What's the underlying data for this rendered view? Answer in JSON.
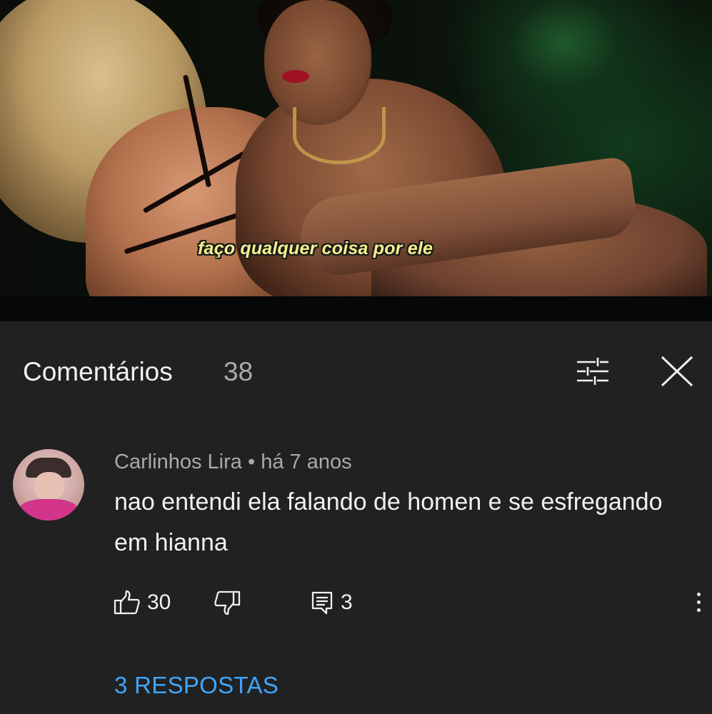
{
  "video": {
    "subtitle": "faço qualquer coisa por ele",
    "progress_fraction": 0.77,
    "colors": {
      "progress": "#c62a20",
      "track": "#9e9e9e",
      "subtitle": "#f4f08c"
    }
  },
  "comments_panel": {
    "title": "Comentários",
    "count": "38",
    "sort_icon": "sort-filter-icon",
    "close_icon": "close-icon"
  },
  "comment": {
    "author": "Carlinhos Lira",
    "separator": "•",
    "time": "há 7 anos",
    "text": "nao entendi ela falando de homen e se esfregando em hianna",
    "likes": "30",
    "replies_count": "3",
    "replies_link": "3 RESPOSTAS",
    "icons": [
      "thumbs-up-icon",
      "thumbs-down-icon",
      "reply-icon",
      "more-vert-icon"
    ]
  },
  "colors": {
    "background": "#212121",
    "link": "#3ea6ff",
    "secondary_text": "#aaaaaa"
  }
}
